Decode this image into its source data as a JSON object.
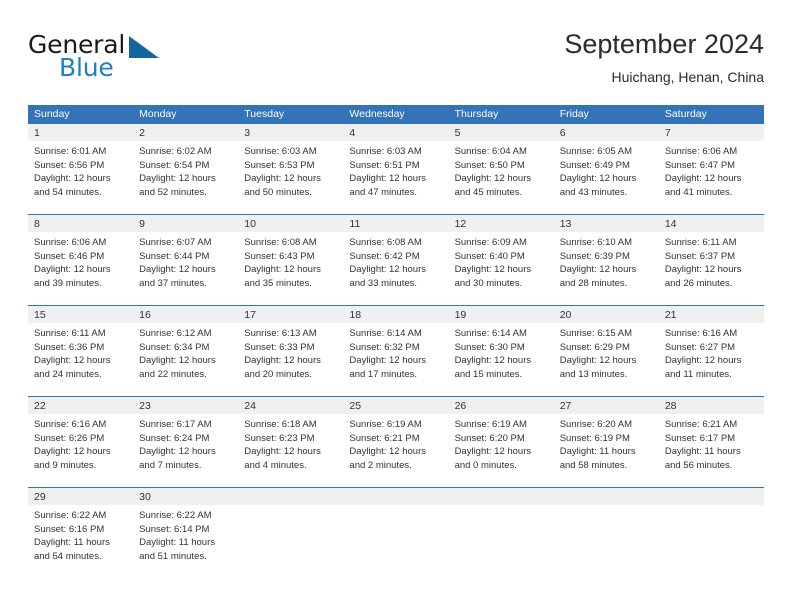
{
  "brand": {
    "name_top": "General",
    "name_bottom": "Blue",
    "triangle_icon": "triangle-icon",
    "color_dark": "#12659f",
    "color_blue": "#1f7fc4"
  },
  "header": {
    "title": "September 2024",
    "subtitle": "Huichang, Henan, China"
  },
  "theme": {
    "header_bg": "#3573b9",
    "date_band_bg": "#f0f0f0",
    "text": "#333333"
  },
  "weekdays": [
    "Sunday",
    "Monday",
    "Tuesday",
    "Wednesday",
    "Thursday",
    "Friday",
    "Saturday"
  ],
  "weeks": [
    {
      "days": [
        {
          "date": "1",
          "sunrise": "Sunrise: 6:01 AM",
          "sunset": "Sunset: 6:56 PM",
          "daylight1": "Daylight: 12 hours",
          "daylight2": "and 54 minutes."
        },
        {
          "date": "2",
          "sunrise": "Sunrise: 6:02 AM",
          "sunset": "Sunset: 6:54 PM",
          "daylight1": "Daylight: 12 hours",
          "daylight2": "and 52 minutes."
        },
        {
          "date": "3",
          "sunrise": "Sunrise: 6:03 AM",
          "sunset": "Sunset: 6:53 PM",
          "daylight1": "Daylight: 12 hours",
          "daylight2": "and 50 minutes."
        },
        {
          "date": "4",
          "sunrise": "Sunrise: 6:03 AM",
          "sunset": "Sunset: 6:51 PM",
          "daylight1": "Daylight: 12 hours",
          "daylight2": "and 47 minutes."
        },
        {
          "date": "5",
          "sunrise": "Sunrise: 6:04 AM",
          "sunset": "Sunset: 6:50 PM",
          "daylight1": "Daylight: 12 hours",
          "daylight2": "and 45 minutes."
        },
        {
          "date": "6",
          "sunrise": "Sunrise: 6:05 AM",
          "sunset": "Sunset: 6:49 PM",
          "daylight1": "Daylight: 12 hours",
          "daylight2": "and 43 minutes."
        },
        {
          "date": "7",
          "sunrise": "Sunrise: 6:06 AM",
          "sunset": "Sunset: 6:47 PM",
          "daylight1": "Daylight: 12 hours",
          "daylight2": "and 41 minutes."
        }
      ]
    },
    {
      "days": [
        {
          "date": "8",
          "sunrise": "Sunrise: 6:06 AM",
          "sunset": "Sunset: 6:46 PM",
          "daylight1": "Daylight: 12 hours",
          "daylight2": "and 39 minutes."
        },
        {
          "date": "9",
          "sunrise": "Sunrise: 6:07 AM",
          "sunset": "Sunset: 6:44 PM",
          "daylight1": "Daylight: 12 hours",
          "daylight2": "and 37 minutes."
        },
        {
          "date": "10",
          "sunrise": "Sunrise: 6:08 AM",
          "sunset": "Sunset: 6:43 PM",
          "daylight1": "Daylight: 12 hours",
          "daylight2": "and 35 minutes."
        },
        {
          "date": "11",
          "sunrise": "Sunrise: 6:08 AM",
          "sunset": "Sunset: 6:42 PM",
          "daylight1": "Daylight: 12 hours",
          "daylight2": "and 33 minutes."
        },
        {
          "date": "12",
          "sunrise": "Sunrise: 6:09 AM",
          "sunset": "Sunset: 6:40 PM",
          "daylight1": "Daylight: 12 hours",
          "daylight2": "and 30 minutes."
        },
        {
          "date": "13",
          "sunrise": "Sunrise: 6:10 AM",
          "sunset": "Sunset: 6:39 PM",
          "daylight1": "Daylight: 12 hours",
          "daylight2": "and 28 minutes."
        },
        {
          "date": "14",
          "sunrise": "Sunrise: 6:11 AM",
          "sunset": "Sunset: 6:37 PM",
          "daylight1": "Daylight: 12 hours",
          "daylight2": "and 26 minutes."
        }
      ]
    },
    {
      "days": [
        {
          "date": "15",
          "sunrise": "Sunrise: 6:11 AM",
          "sunset": "Sunset: 6:36 PM",
          "daylight1": "Daylight: 12 hours",
          "daylight2": "and 24 minutes."
        },
        {
          "date": "16",
          "sunrise": "Sunrise: 6:12 AM",
          "sunset": "Sunset: 6:34 PM",
          "daylight1": "Daylight: 12 hours",
          "daylight2": "and 22 minutes."
        },
        {
          "date": "17",
          "sunrise": "Sunrise: 6:13 AM",
          "sunset": "Sunset: 6:33 PM",
          "daylight1": "Daylight: 12 hours",
          "daylight2": "and 20 minutes."
        },
        {
          "date": "18",
          "sunrise": "Sunrise: 6:14 AM",
          "sunset": "Sunset: 6:32 PM",
          "daylight1": "Daylight: 12 hours",
          "daylight2": "and 17 minutes."
        },
        {
          "date": "19",
          "sunrise": "Sunrise: 6:14 AM",
          "sunset": "Sunset: 6:30 PM",
          "daylight1": "Daylight: 12 hours",
          "daylight2": "and 15 minutes."
        },
        {
          "date": "20",
          "sunrise": "Sunrise: 6:15 AM",
          "sunset": "Sunset: 6:29 PM",
          "daylight1": "Daylight: 12 hours",
          "daylight2": "and 13 minutes."
        },
        {
          "date": "21",
          "sunrise": "Sunrise: 6:16 AM",
          "sunset": "Sunset: 6:27 PM",
          "daylight1": "Daylight: 12 hours",
          "daylight2": "and 11 minutes."
        }
      ]
    },
    {
      "days": [
        {
          "date": "22",
          "sunrise": "Sunrise: 6:16 AM",
          "sunset": "Sunset: 6:26 PM",
          "daylight1": "Daylight: 12 hours",
          "daylight2": "and 9 minutes."
        },
        {
          "date": "23",
          "sunrise": "Sunrise: 6:17 AM",
          "sunset": "Sunset: 6:24 PM",
          "daylight1": "Daylight: 12 hours",
          "daylight2": "and 7 minutes."
        },
        {
          "date": "24",
          "sunrise": "Sunrise: 6:18 AM",
          "sunset": "Sunset: 6:23 PM",
          "daylight1": "Daylight: 12 hours",
          "daylight2": "and 4 minutes."
        },
        {
          "date": "25",
          "sunrise": "Sunrise: 6:19 AM",
          "sunset": "Sunset: 6:21 PM",
          "daylight1": "Daylight: 12 hours",
          "daylight2": "and 2 minutes."
        },
        {
          "date": "26",
          "sunrise": "Sunrise: 6:19 AM",
          "sunset": "Sunset: 6:20 PM",
          "daylight1": "Daylight: 12 hours",
          "daylight2": "and 0 minutes."
        },
        {
          "date": "27",
          "sunrise": "Sunrise: 6:20 AM",
          "sunset": "Sunset: 6:19 PM",
          "daylight1": "Daylight: 11 hours",
          "daylight2": "and 58 minutes."
        },
        {
          "date": "28",
          "sunrise": "Sunrise: 6:21 AM",
          "sunset": "Sunset: 6:17 PM",
          "daylight1": "Daylight: 11 hours",
          "daylight2": "and 56 minutes."
        }
      ]
    },
    {
      "days": [
        {
          "date": "29",
          "sunrise": "Sunrise: 6:22 AM",
          "sunset": "Sunset: 6:16 PM",
          "daylight1": "Daylight: 11 hours",
          "daylight2": "and 54 minutes."
        },
        {
          "date": "30",
          "sunrise": "Sunrise: 6:22 AM",
          "sunset": "Sunset: 6:14 PM",
          "daylight1": "Daylight: 11 hours",
          "daylight2": "and 51 minutes."
        },
        {
          "date": "",
          "sunrise": "",
          "sunset": "",
          "daylight1": "",
          "daylight2": ""
        },
        {
          "date": "",
          "sunrise": "",
          "sunset": "",
          "daylight1": "",
          "daylight2": ""
        },
        {
          "date": "",
          "sunrise": "",
          "sunset": "",
          "daylight1": "",
          "daylight2": ""
        },
        {
          "date": "",
          "sunrise": "",
          "sunset": "",
          "daylight1": "",
          "daylight2": ""
        },
        {
          "date": "",
          "sunrise": "",
          "sunset": "",
          "daylight1": "",
          "daylight2": ""
        }
      ]
    }
  ]
}
